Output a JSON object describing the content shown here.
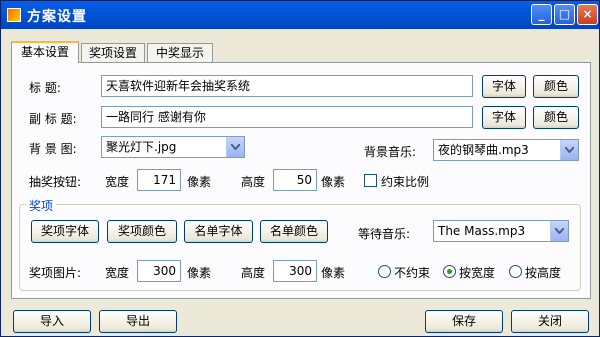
{
  "window": {
    "title": "方案设置",
    "min_label": "_",
    "max_label": "□",
    "close_label": "×"
  },
  "tabs": [
    "基本设置",
    "奖项设置",
    "中奖显示"
  ],
  "basic": {
    "title_label": "标   题:",
    "title_value": "天喜软件迎新年会抽奖系统",
    "subtitle_label": "副 标 题:",
    "subtitle_value": "一路同行 感谢有你",
    "font_btn": "字体",
    "color_btn": "颜色",
    "bg_image_label": "背 景 图:",
    "bg_image_value": "聚光灯下.jpg",
    "bg_music_label": "背景音乐:",
    "bg_music_value": "夜的钢琴曲.mp3",
    "draw_button_label": "抽奖按钮:",
    "width_label": "宽度",
    "draw_width": "171",
    "height_label": "高度",
    "draw_height": "50",
    "pixel_label": "像素",
    "lock_ratio_label": "约束比例"
  },
  "prize": {
    "group_title": "奖项",
    "prize_font_btn": "奖项字体",
    "prize_color_btn": "奖项颜色",
    "list_font_btn": "名单字体",
    "list_color_btn": "名单颜色",
    "wait_music_label": "等待音乐:",
    "wait_music_value": "The Mass.mp3",
    "prize_image_label": "奖项图片:",
    "width_label": "宽度",
    "image_width": "300",
    "height_label": "高度",
    "image_height": "300",
    "pixel_label": "像素",
    "radio_unconstrained": "不约束",
    "radio_by_width": "按宽度",
    "radio_by_height": "按高度",
    "selected_radio": "按宽度"
  },
  "footer": {
    "import_btn": "导入",
    "export_btn": "导出",
    "save_btn": "保存",
    "close_btn": "关闭"
  }
}
